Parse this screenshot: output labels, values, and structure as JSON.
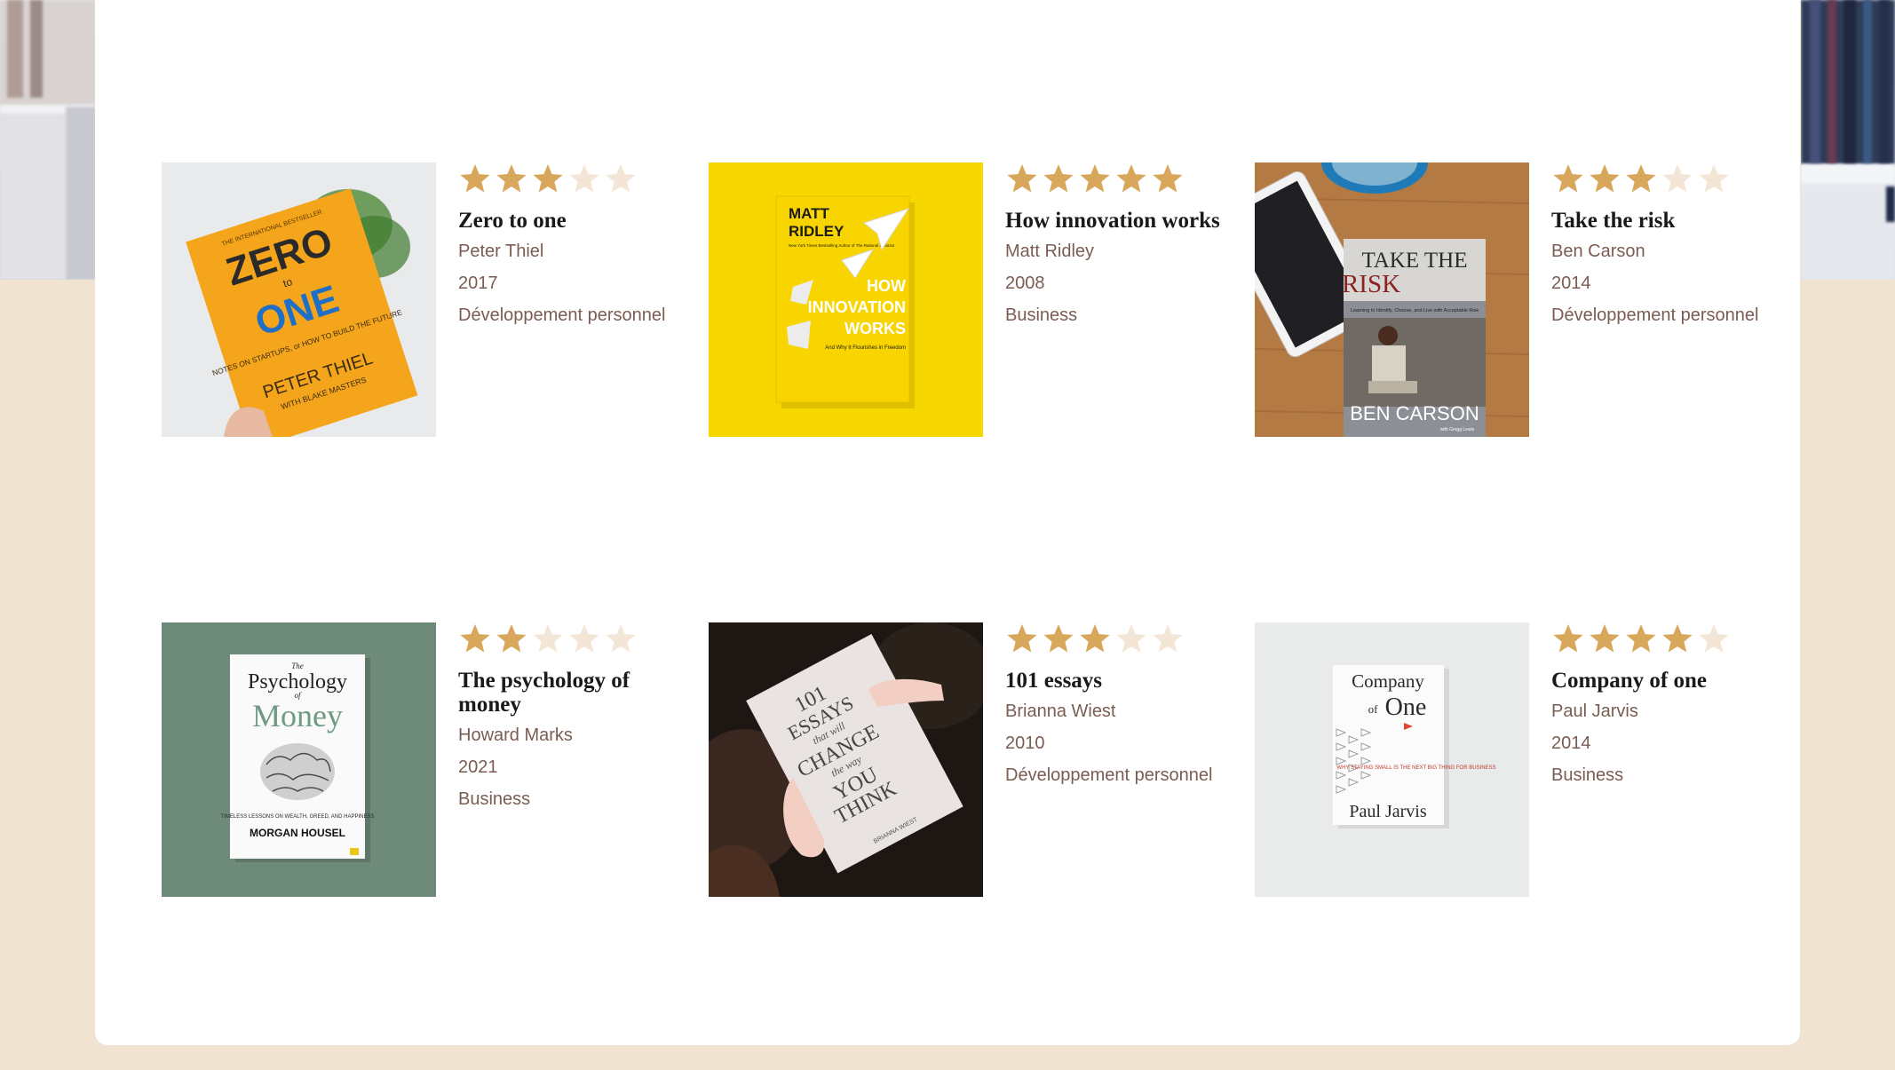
{
  "colors": {
    "page_bg": "#f1e3d1",
    "card_bg": "#ffffff",
    "star_filled": "#d9a75c",
    "star_empty": "#f4e6d6",
    "title_text": "#1a1a1a",
    "meta_text": "#7a5c52"
  },
  "books": [
    {
      "rating": 3,
      "title": "Zero to one",
      "author": "Peter Thiel",
      "year": "2017",
      "category": "Développement personnel",
      "cover": {
        "bg": "#e9eaec",
        "line1": "ZERO",
        "line2": "to",
        "line3": "ONE",
        "subtitle": "NOTES ON STARTUPS, or HOW TO BUILD THE FUTURE",
        "author_line": "PETER THIEL",
        "coauthor_line": "WITH BLAKE MASTERS",
        "tagline": "THE INTERNATIONAL BESTSELLER"
      }
    },
    {
      "rating": 5,
      "title": "How innovation works",
      "author": "Matt Ridley",
      "year": "2008",
      "category": "Business",
      "cover": {
        "bg": "#f6d800",
        "author1": "MATT",
        "author2": "RIDLEY",
        "tagline": "New York Times Bestselling Author of The Rational Optimist",
        "title1": "HOW",
        "title2": "INNOVATION",
        "title3": "WORKS",
        "subtitle": "And Why It Flourishes in Freedom"
      }
    },
    {
      "rating": 3,
      "title": "Take the risk",
      "author": "Ben Carson",
      "year": "2014",
      "category": "Développement personnel",
      "cover": {
        "bg": "#b47a44",
        "title1": "TAKE THE",
        "title2": "RISK",
        "subtitle": "Learning to Identify, Choose, and Live with Acceptable Risk",
        "author_line": "BEN CARSON",
        "coauthor_line": "with Gregg Lewis"
      }
    },
    {
      "rating": 2,
      "title": "The psychology of money",
      "author": "Howard Marks",
      "year": "2021",
      "category": "Business",
      "cover": {
        "bg": "#6e8a78",
        "title1": "The",
        "title2": "Psychology",
        "title3": "of",
        "title4": "Money",
        "subtitle": "TIMELESS LESSONS ON WEALTH, GREED, AND HAPPINESS",
        "author_line": "MORGAN HOUSEL"
      }
    },
    {
      "rating": 3,
      "title": "101 essays",
      "author": "Brianna Wiest",
      "year": "2010",
      "category": "Développement personnel",
      "cover": {
        "bg": "#1d1714",
        "title1": "101",
        "title2": "ESSAYS",
        "title3": "that will",
        "title4": "CHANGE",
        "title5": "the way",
        "title6": "YOU",
        "title7": "THINK",
        "author_line": "BRIANNA WIEST"
      }
    },
    {
      "rating": 4,
      "title": "Company of one",
      "author": "Paul Jarvis",
      "year": "2014",
      "category": "Business",
      "cover": {
        "bg": "#e9eaea",
        "title1": "Company",
        "title2": "of",
        "title3": "One",
        "subtitle": "WHY STAYING SMALL IS THE NEXT BIG THING FOR BUSINESS",
        "author_line": "Paul Jarvis"
      }
    }
  ]
}
